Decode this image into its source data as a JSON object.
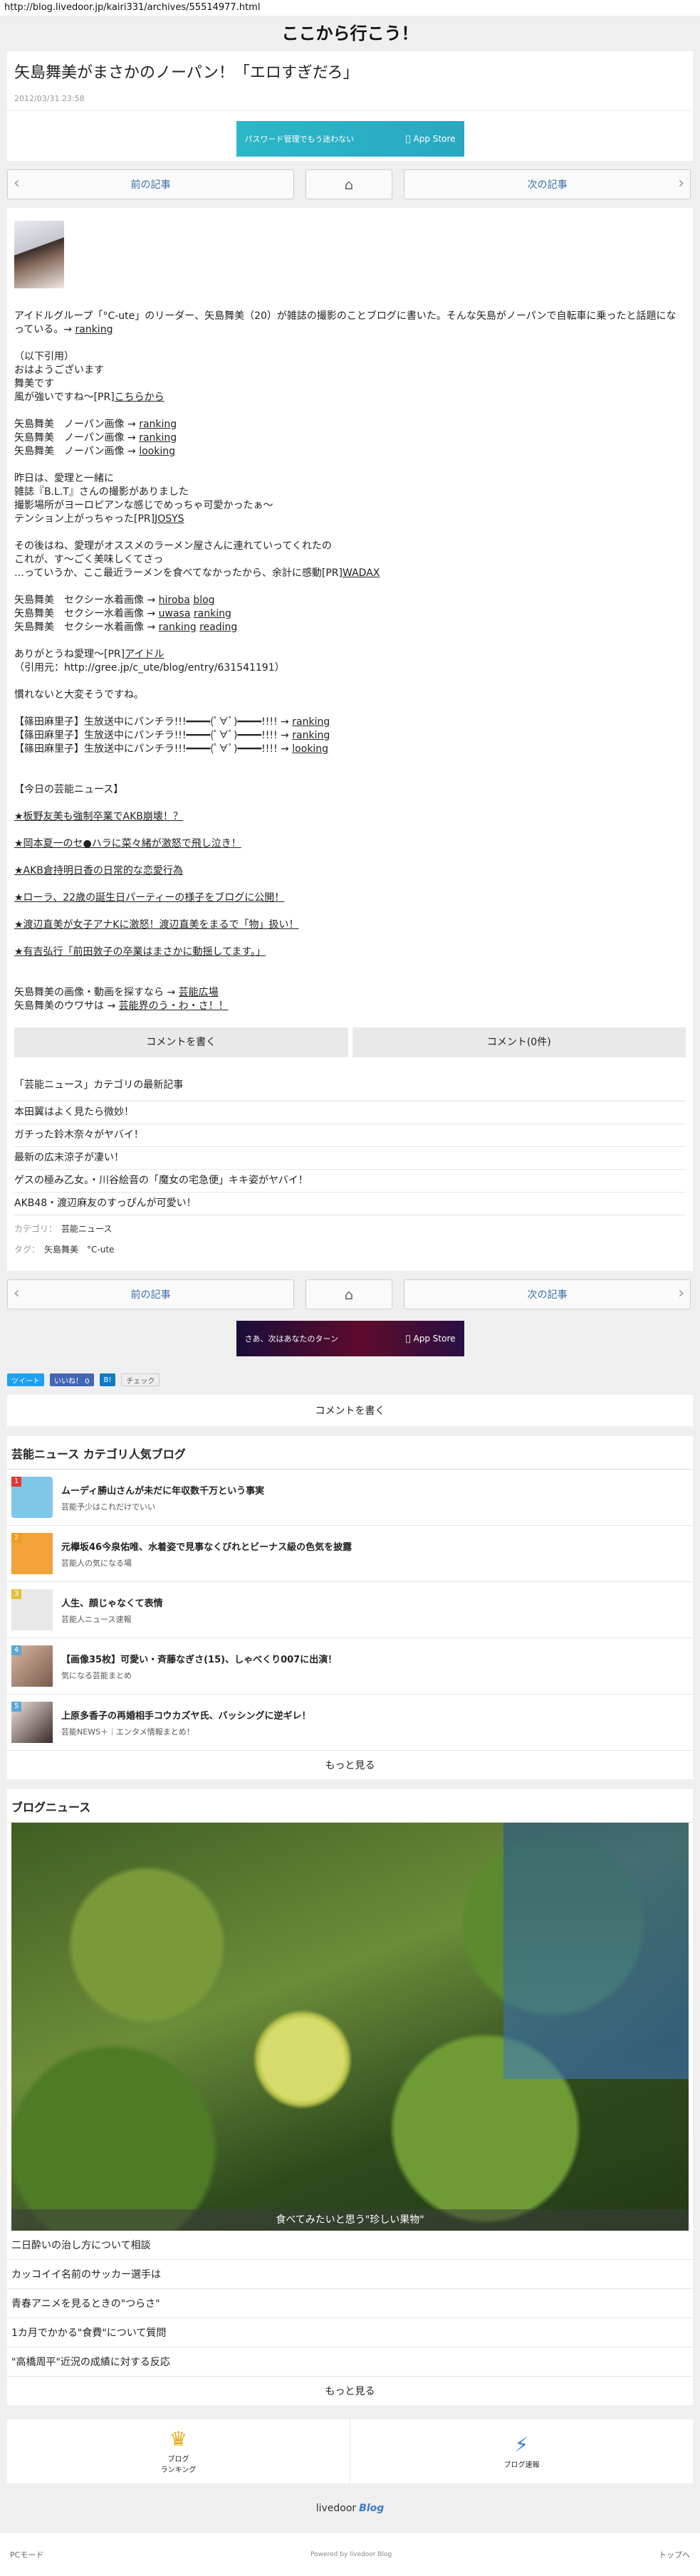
{
  "url": "http://blog.livedoor.jp/kairi331/archives/55514977.html",
  "site_title": "ここから行こう！",
  "article": {
    "title": "矢島舞美がまさかのノーパン！「エロすぎだろ」",
    "date": "2012/03/31 23:58"
  },
  "banner1": {
    "text": "パスワード管理でもう迷わない",
    "store": "App Store"
  },
  "banner2": {
    "text": "さあ、次はあなたのターン",
    "store": "App Store"
  },
  "pager": {
    "prev": "前の記事",
    "next": "次の記事"
  },
  "body": {
    "intro": "アイドルグループ「°C-ute」のリーダー、矢島舞美（20）が雑誌の撮影のことブログに書いた。そんな矢島がノーパンで自転車に乗ったと話題になっている。→",
    "intro_link": "ranking",
    "q1": "（以下引用）",
    "q2": "おはようございます",
    "q3": "舞美です",
    "q4": "風が強いですね〜[PR]",
    "q4_link": "こちらから",
    "n1": "矢島舞美　ノーパン画像 →",
    "n1l": "ranking",
    "n2": "矢島舞美　ノーパン画像 →",
    "n2l": "ranking",
    "n3": "矢島舞美　ノーパン画像 →",
    "n3l": "looking",
    "p1": "昨日は、愛理と一緒に",
    "p2": "雑誌『B.L.T』さんの撮影がありました",
    "p3": "撮影場所がヨーロピアンな感じでめっちゃ可愛かったぁ〜",
    "p4": "テンション上がっちゃった[PR]",
    "p4l": "JOSYS",
    "r1": "その後はね、愛理がオススメのラーメン屋さんに連れていってくれたの",
    "r2": "これが、す〜ごく美味しくてさっ",
    "r3": "…っていうか、ここ最近ラーメンを食べてなかったから、余計に感動[PR]",
    "r3l": "WADAX",
    "s1": "矢島舞美　セクシー水着画像 →",
    "s1l1": "hiroba",
    "s1l2": "blog",
    "s2": "矢島舞美　セクシー水着画像 →",
    "s2l1": "uwasa",
    "s2l2": "ranking",
    "s3": "矢島舞美　セクシー水着画像 →",
    "s3l1": "ranking",
    "s3l2": "reading",
    "t1": "ありがとうね愛理〜[PR]",
    "t1l": "アイドル",
    "t2": "（引用元：http://gree.jp/c_ute/blog/entry/631541191）",
    "u1": "慣れないと大変そうですね。",
    "v1": "【篠田麻里子】生放送中にパンチラ!!!━━━━(ﾟ∀ﾟ)━━━━!!!! →",
    "v1l": "ranking",
    "v2": "【篠田麻里子】生放送中にパンチラ!!!━━━━(ﾟ∀ﾟ)━━━━!!!! →",
    "v2l": "ranking",
    "v3": "【篠田麻里子】生放送中にパンチラ!!!━━━━(ﾟ∀ﾟ)━━━━!!!! →",
    "v3l": "looking",
    "today": "【今日の芸能ニュース】",
    "today_items": [
      "★板野友美も強制卒業でAKB崩壊！？",
      "★岡本夏一のセ●ハラに菜々緒が激怒で飛し泣き！",
      "★AKB倉持明日香の日常的な恋愛行為",
      "★ローラ、22歳の誕生日パーティーの様子をブログに公開！",
      "★渡辺直美が女子アナKに激怒！渡辺直美をまるで「物」扱い！",
      "★有吉弘行「前田敦子の卒業はまさかに動揺してます。」"
    ],
    "w1": "矢島舞美の画像・動画を探すなら →",
    "w1l": "芸能広場",
    "w2": "矢島舞美のウワサは →",
    "w2l": "芸能界のう・わ・さ！！"
  },
  "actions": {
    "write": "コメントを書く",
    "count": "コメント(0件)"
  },
  "latest": {
    "heading": "「芸能ニュース」カテゴリの最新記事",
    "items": [
      "本田翼はよく見たら微妙！",
      "ガチった鈴木奈々がヤバイ！",
      "最新の広末涼子が凄い！",
      "ゲスの極み乙女。・川谷絵音の「魔女の宅急便」キキ姿がヤバイ！",
      "AKB48・渡辺麻友のすっぴんが可愛い！"
    ]
  },
  "meta": {
    "cat_label": "カテゴリ：",
    "cat": "芸能ニュース",
    "tag_label": "タグ：",
    "tags": "矢島舞美　°C-ute"
  },
  "social": {
    "tweet": "ツイート",
    "like": "いいね！ 0",
    "hatena": "B!",
    "check": "チェック"
  },
  "comment_full": "コメントを書く",
  "popular": {
    "heading": "芸能ニュース カテゴリ人気ブログ",
    "items": [
      {
        "n": "1",
        "t": "ムーディ勝山さんが未だに年収数千万という事実",
        "s": "芸能予少はこれだけでいい"
      },
      {
        "n": "2",
        "t": "元欅坂46今泉佑唯、水着姿で見事なくびれとビーナス級の色気を披露",
        "s": "芸能人の気になる場"
      },
      {
        "n": "3",
        "t": "人生、顔じゃなくて表情",
        "s": "芸能人ニュース速報"
      },
      {
        "n": "4",
        "t": "【画像35枚】可愛い・斉藤なぎさ(15)、しゃべくり007に出演！",
        "s": "気になる芸能まとめ"
      },
      {
        "n": "5",
        "t": "上原多香子の再婚相手コウカズヤ氏、バッシングに逆ギレ！",
        "s": "芸能NEWS＋｜エンタメ情報まとめ！"
      }
    ],
    "more": "もっと見る"
  },
  "blognews": {
    "heading": "ブログニュース",
    "caption": "食べてみたいと思う\"珍しい果物\"",
    "items": [
      "二日酔いの治し方について相談",
      "カッコイイ名前のサッカー選手は",
      "青春アニメを見るときの\"つらさ\"",
      "1カ月でかかる\"食費\"について質問",
      "\"高橋周平\"近況の成績に対する反応"
    ],
    "more": "もっと見る"
  },
  "foot": {
    "ranking": "ブログ\nランキング",
    "bulletin": "ブログ速報"
  },
  "brand": {
    "a": "livedoor",
    "b": "Blog"
  },
  "bottom": {
    "pc": "PCモード",
    "powered": "Powered by livedoor Blog",
    "top": "トップへ"
  }
}
